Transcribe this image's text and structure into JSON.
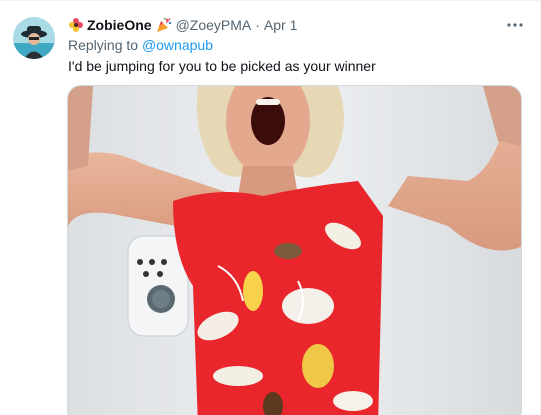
{
  "tweet": {
    "display_name": "ZobieOne",
    "handle": "@ZoeyPMA",
    "separator": "·",
    "date": "Apr 1",
    "reply_prefix": "Replying to ",
    "reply_to": "@ownapub",
    "text": "I'd be jumping for you to be picked as your winner",
    "more_icon": "more-horizontal-icon",
    "media_alt": "photo-woman-jumping-red-floral-dress"
  },
  "colors": {
    "link": "#1d9bf0",
    "secondary_text": "#536471",
    "primary_text": "#0f1419",
    "dress_red": "#e8262b"
  }
}
